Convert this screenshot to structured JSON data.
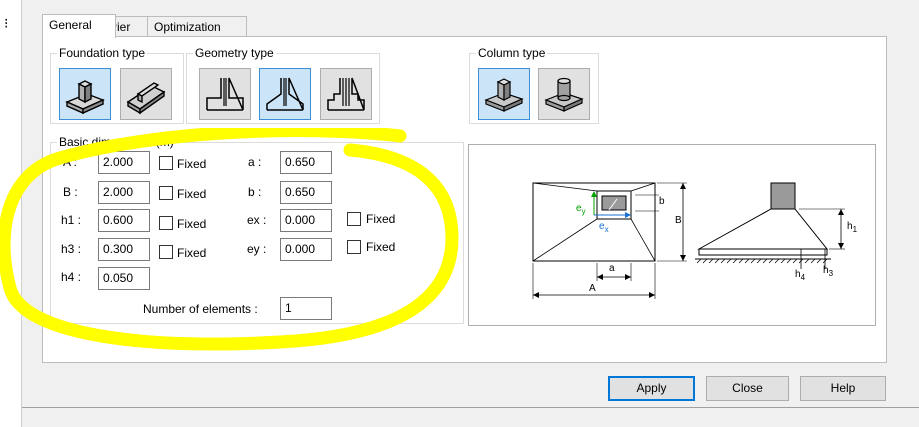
{
  "left_strip_glyph": "⁝",
  "tabs": [
    {
      "label": "General",
      "active": true
    },
    {
      "label": "Pier",
      "active": false
    },
    {
      "label": "Optimization",
      "active": false
    }
  ],
  "foundation_type": {
    "legend": "Foundation type",
    "buttons": [
      {
        "icon": "isolated-footing-icon",
        "selected": true
      },
      {
        "icon": "strip-footing-icon",
        "selected": false
      }
    ]
  },
  "geometry_type": {
    "legend": "Geometry type",
    "buttons": [
      {
        "icon": "rectangular-footing-icon",
        "selected": false
      },
      {
        "icon": "sloped-footing-icon",
        "selected": true
      },
      {
        "icon": "stepped-footing-icon",
        "selected": false
      }
    ]
  },
  "column_type": {
    "legend": "Column type",
    "buttons": [
      {
        "icon": "rectangular-column-icon",
        "selected": true
      },
      {
        "icon": "circular-column-icon",
        "selected": false
      }
    ]
  },
  "basic_dimensions": {
    "legend": "Basic dimensions (m)",
    "fixed_label": "Fixed",
    "A": {
      "label": "A :",
      "value": "2.000",
      "fixed": false
    },
    "B": {
      "label": "B :",
      "value": "2.000",
      "fixed": false
    },
    "h1": {
      "label": "h1 :",
      "value": "0.600",
      "fixed": false
    },
    "h3": {
      "label": "h3 :",
      "value": "0.300",
      "fixed": false
    },
    "h4": {
      "label": "h4 :",
      "value": "0.050"
    },
    "a": {
      "label": "a :",
      "value": "0.650"
    },
    "b": {
      "label": "b :",
      "value": "0.650"
    },
    "ex": {
      "label": "ex :",
      "value": "0.000",
      "fixed": false
    },
    "ey": {
      "label": "ey :",
      "value": "0.000",
      "fixed": false
    },
    "number_of_elements": {
      "label": "Number of elements :",
      "value": "1"
    }
  },
  "diagram_labels": {
    "ey": "e",
    "ey_sub": "y",
    "ex": "e",
    "ex_sub": "x",
    "b": "b",
    "B": "B",
    "a": "a",
    "A": "A",
    "h1": "h",
    "h1_sub": "1",
    "h4": "h",
    "h4_sub": "4",
    "h3": "h",
    "h3_sub": "3"
  },
  "buttons": {
    "apply": "Apply",
    "close": "Close",
    "help": "Help"
  },
  "colors": {
    "selected_bg": "#cce4f7",
    "selected_border": "#3c8fd6",
    "highlight": "#ffff00",
    "diagram_green": "#00a000",
    "diagram_blue": "#1a6fd6"
  }
}
